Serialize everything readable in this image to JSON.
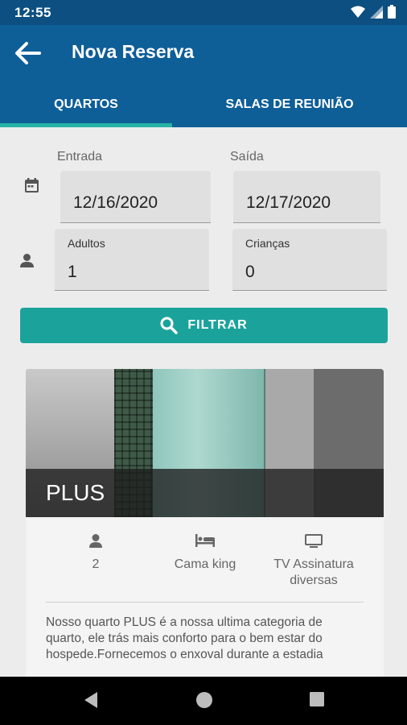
{
  "status_bar": {
    "time": "12:55",
    "icons": [
      "wifi-icon",
      "signal-icon",
      "battery-icon"
    ]
  },
  "app_bar": {
    "title": "Nova Reserva",
    "back_icon": "arrow-left-icon"
  },
  "tabs": [
    {
      "label": "QUARTOS",
      "active": true
    },
    {
      "label": "SALAS DE REUNIÃO",
      "active": false
    }
  ],
  "dates": {
    "checkin_label": "Entrada",
    "checkin_value": "12/16/2020",
    "checkout_label": "Saída",
    "checkout_value": "12/17/2020",
    "icon": "calendar-icon"
  },
  "guests": {
    "adults_label": "Adultos",
    "adults_value": "1",
    "children_label": "Crianças",
    "children_value": "0",
    "icon": "person-icon"
  },
  "filter_button": {
    "label": "FILTRAR",
    "icon": "search-icon"
  },
  "room_card": {
    "name": "PLUS",
    "amenities": [
      {
        "icon": "person-icon",
        "label": "2"
      },
      {
        "icon": "bed-icon",
        "label": "Cama king"
      },
      {
        "icon": "tv-icon",
        "label_line1": "TV Assinatura",
        "label_line2": "diversas"
      }
    ],
    "description_lines": [
      "Nosso quarto PLUS é a nossa ultima categoria de",
      "quarto, ele trás mais conforto para o bem estar do",
      "hospede.Fornecemos o enxoval durante a estadia"
    ]
  },
  "colors": {
    "status_bar": "#0d4f80",
    "app_bar": "#0e5e98",
    "accent": "#1ba39b",
    "tab_indicator": "#27b2a5"
  },
  "nav_bar": {
    "icons": [
      "back-triangle-icon",
      "home-circle-icon",
      "recents-square-icon"
    ]
  }
}
